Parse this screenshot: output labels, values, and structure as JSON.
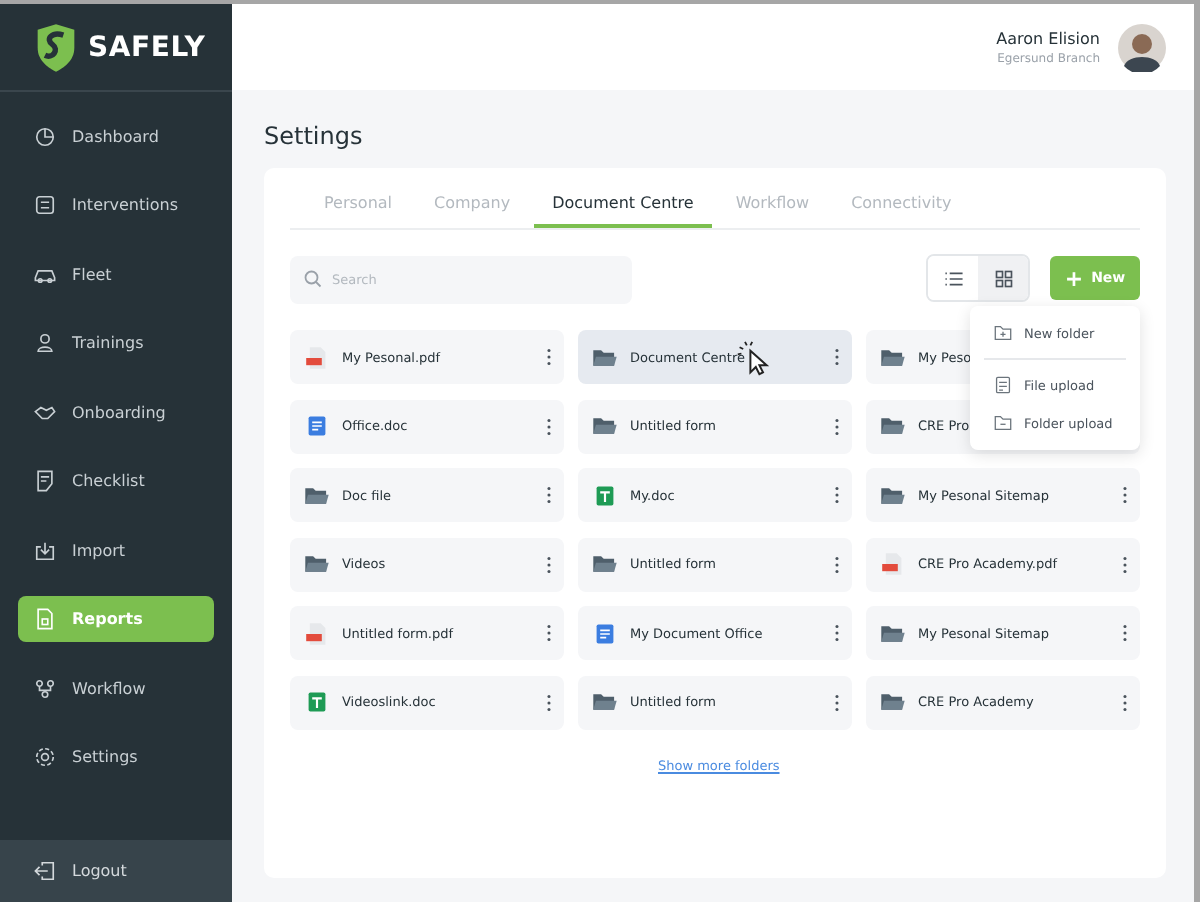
{
  "brand": "SAFELY",
  "sidebar": {
    "items": [
      {
        "label": "Dashboard",
        "selected": false
      },
      {
        "label": "Interventions",
        "selected": false
      },
      {
        "label": "Fleet",
        "selected": false
      },
      {
        "label": "Trainings",
        "selected": false
      },
      {
        "label": "Onboarding",
        "selected": false
      },
      {
        "label": "Checklist",
        "selected": false
      },
      {
        "label": "Import",
        "selected": false
      },
      {
        "label": "Reports",
        "selected": true
      },
      {
        "label": "Workflow",
        "selected": false
      },
      {
        "label": "Settings",
        "selected": false
      }
    ],
    "footer": "Logout"
  },
  "user": {
    "name": "Aaron Elision",
    "branch": "Egersund Branch"
  },
  "page_title": "Settings",
  "tabs": [
    {
      "label": "Personal",
      "selected": false
    },
    {
      "label": "Company",
      "selected": false
    },
    {
      "label": "Document Centre",
      "selected": true
    },
    {
      "label": "Workflow",
      "selected": false
    },
    {
      "label": "Connectivity",
      "selected": false
    }
  ],
  "search": {
    "placeholder": "Search"
  },
  "view_toggle": [
    {
      "kind": "list",
      "selected": false
    },
    {
      "kind": "grid",
      "selected": true
    }
  ],
  "new_button": {
    "icon": "+",
    "label": "New"
  },
  "new_menu": [
    {
      "label": "New folder",
      "kind": "folder-add"
    },
    {
      "label": "File upload",
      "kind": "file"
    },
    {
      "label": "Folder upload",
      "kind": "folder-up"
    }
  ],
  "files": [
    {
      "name": "My Pesonal.pdf",
      "kind": "pdf",
      "selected": false
    },
    {
      "name": "Document Centre",
      "kind": "folder",
      "selected": true
    },
    {
      "name": "My Peso",
      "kind": "folder",
      "selected": false
    },
    {
      "name": "Office.doc",
      "kind": "doc",
      "selected": false
    },
    {
      "name": "Untitled form",
      "kind": "folder",
      "selected": false
    },
    {
      "name": "CRE Pro",
      "kind": "folder",
      "selected": false
    },
    {
      "name": "Doc file",
      "kind": "folder",
      "selected": false
    },
    {
      "name": "My.doc",
      "kind": "sheet",
      "selected": false
    },
    {
      "name": "My Pesonal Sitemap",
      "kind": "folder",
      "selected": false
    },
    {
      "name": "Videos",
      "kind": "folder",
      "selected": false
    },
    {
      "name": "Untitled form",
      "kind": "folder",
      "selected": false
    },
    {
      "name": "CRE Pro Academy.pdf",
      "kind": "pdf",
      "selected": false
    },
    {
      "name": "Untitled form.pdf",
      "kind": "pdf",
      "selected": false
    },
    {
      "name": "My Document Office",
      "kind": "doc",
      "selected": false
    },
    {
      "name": "My Pesonal Sitemap",
      "kind": "folder",
      "selected": false
    },
    {
      "name": "Videoslink.doc",
      "kind": "sheet",
      "selected": false
    },
    {
      "name": "Untitled form",
      "kind": "folder",
      "selected": false
    },
    {
      "name": "CRE Pro Academy",
      "kind": "folder",
      "selected": false
    }
  ],
  "more_link": "Show more folders"
}
